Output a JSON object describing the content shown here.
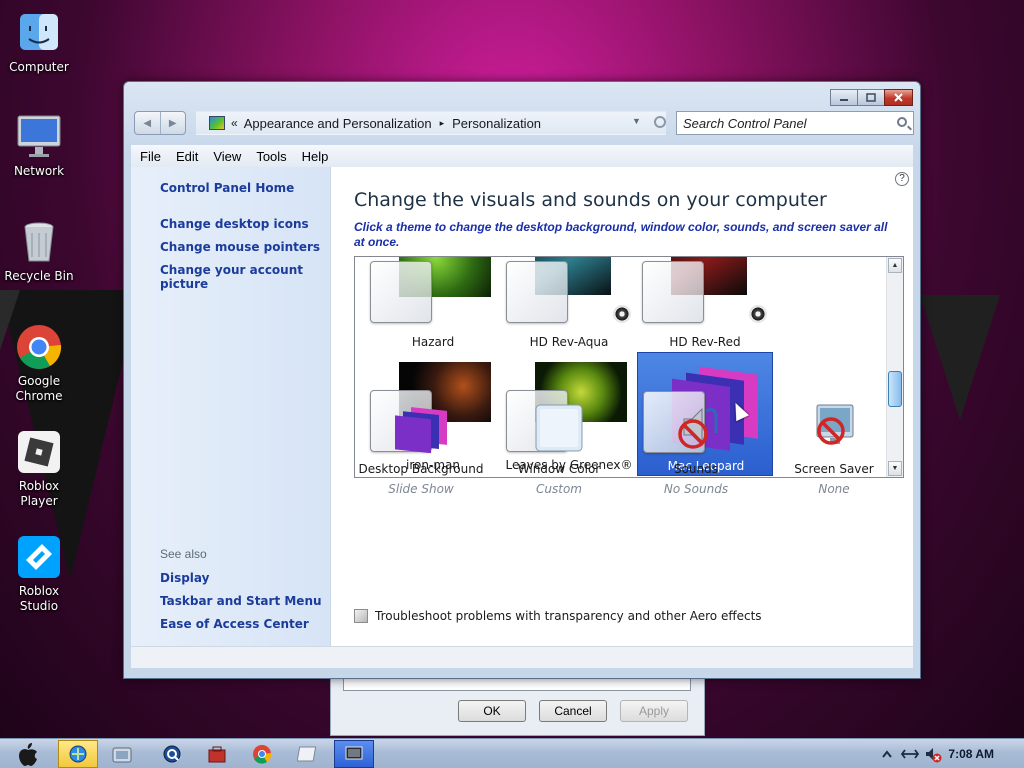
{
  "desktop": {
    "icons": [
      {
        "label": "Computer",
        "icon": "finder-icon"
      },
      {
        "label": "Network",
        "icon": "imac-icon"
      },
      {
        "label": "Recycle Bin",
        "icon": "trash-icon"
      },
      {
        "label": "Google Chrome",
        "icon": "chrome-icon"
      },
      {
        "label": "Roblox Player",
        "icon": "roblox-icon"
      },
      {
        "label": "Roblox Studio",
        "icon": "roblox-studio-icon"
      }
    ]
  },
  "window": {
    "breadcrumb": {
      "overflow": "«",
      "items": [
        "Appearance and Personalization",
        "Personalization"
      ],
      "separator": "▸"
    },
    "search_placeholder": "Search Control Panel",
    "menu": [
      "File",
      "Edit",
      "View",
      "Tools",
      "Help"
    ],
    "left_pane": {
      "home": "Control Panel Home",
      "links": [
        "Change desktop icons",
        "Change mouse pointers",
        "Change your account picture"
      ],
      "see_also_label": "See also",
      "see_also": [
        "Display",
        "Taskbar and Start Menu",
        "Ease of Access Center"
      ]
    },
    "title": "Change the visuals and sounds on your computer",
    "subtitle": "Click a theme to change the desktop background, window color, sounds, and screen saver all at once.",
    "themes": [
      {
        "name": "Hazard",
        "has_sounds_icon": false,
        "selected": false
      },
      {
        "name": "HD Rev-Aqua",
        "has_sounds_icon": true,
        "selected": false
      },
      {
        "name": "HD Rev-Red",
        "has_sounds_icon": true,
        "selected": false
      },
      {
        "name": "iron-man",
        "has_sounds_icon": false,
        "selected": false
      },
      {
        "name": "Leaves by Greenex®",
        "has_sounds_icon": false,
        "selected": false
      },
      {
        "name": "Mac Leopard",
        "has_sounds_icon": false,
        "selected": true
      }
    ],
    "options": [
      {
        "name": "Desktop Background",
        "value": "Slide Show"
      },
      {
        "name": "Window Color",
        "value": "Custom"
      },
      {
        "name": "Sounds",
        "value": "No Sounds"
      },
      {
        "name": "Screen Saver",
        "value": "None"
      }
    ],
    "troubleshoot": "Troubleshoot problems with transparency and other Aero effects"
  },
  "dialog_behind": {
    "ok": "OK",
    "cancel": "Cancel",
    "apply": "Apply"
  },
  "taskbar": {
    "clock": "7:08 AM"
  },
  "colors": {
    "link": "#1c3c9c",
    "selected_theme": "#2b5fcf",
    "desktop_accent": "#d21e9e"
  }
}
